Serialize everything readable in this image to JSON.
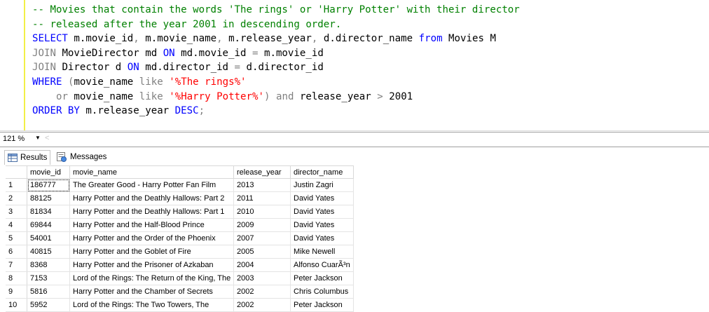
{
  "editor": {
    "lines": [
      [
        {
          "t": "-- Movies that contain the words 'The rings' or 'Harry Potter' with their director",
          "c": "cm"
        }
      ],
      [
        {
          "t": "-- released after the year 2001 in descending order.",
          "c": "cm"
        }
      ],
      [
        {
          "t": "SELECT",
          "c": "kw"
        },
        {
          "t": " m.movie_id",
          "c": ""
        },
        {
          "t": ",",
          "c": "op"
        },
        {
          "t": " m.movie_name",
          "c": ""
        },
        {
          "t": ",",
          "c": "op"
        },
        {
          "t": " m.release_year",
          "c": ""
        },
        {
          "t": ",",
          "c": "op"
        },
        {
          "t": " d.director_name ",
          "c": ""
        },
        {
          "t": "from",
          "c": "kw"
        },
        {
          "t": " Movies M",
          "c": ""
        }
      ],
      [
        {
          "t": "JOIN",
          "c": "op"
        },
        {
          "t": " MovieDirector md ",
          "c": ""
        },
        {
          "t": "ON",
          "c": "kw"
        },
        {
          "t": " md.movie_id ",
          "c": ""
        },
        {
          "t": "=",
          "c": "op"
        },
        {
          "t": " m.movie_id",
          "c": ""
        }
      ],
      [
        {
          "t": "JOIN",
          "c": "op"
        },
        {
          "t": " Director d ",
          "c": ""
        },
        {
          "t": "ON",
          "c": "kw"
        },
        {
          "t": " md.director_id ",
          "c": ""
        },
        {
          "t": "=",
          "c": "op"
        },
        {
          "t": " d.director_id",
          "c": ""
        }
      ],
      [
        {
          "t": "WHERE",
          "c": "kw"
        },
        {
          "t": " ",
          "c": ""
        },
        {
          "t": "(",
          "c": "op"
        },
        {
          "t": "movie_name ",
          "c": ""
        },
        {
          "t": "like",
          "c": "op"
        },
        {
          "t": " ",
          "c": ""
        },
        {
          "t": "'%The rings%'",
          "c": "str"
        }
      ],
      [
        {
          "t": "    ",
          "c": ""
        },
        {
          "t": "or",
          "c": "op"
        },
        {
          "t": " movie_name ",
          "c": ""
        },
        {
          "t": "like",
          "c": "op"
        },
        {
          "t": " ",
          "c": ""
        },
        {
          "t": "'%Harry Potter%'",
          "c": "str"
        },
        {
          "t": ")",
          "c": "op"
        },
        {
          "t": " ",
          "c": ""
        },
        {
          "t": "and",
          "c": "op"
        },
        {
          "t": " release_year ",
          "c": ""
        },
        {
          "t": ">",
          "c": "op"
        },
        {
          "t": " 2001",
          "c": ""
        }
      ],
      [
        {
          "t": "ORDER BY",
          "c": "kw"
        },
        {
          "t": " m.release_year ",
          "c": ""
        },
        {
          "t": "DESC",
          "c": "kw"
        },
        {
          "t": ";",
          "c": "op"
        }
      ]
    ]
  },
  "statusbar": {
    "zoom": "121 %",
    "scroll_left": "<"
  },
  "tabs": {
    "results": "Results",
    "messages": "Messages"
  },
  "grid": {
    "columns": [
      "movie_id",
      "movie_name",
      "release_year",
      "director_name"
    ],
    "rows": [
      [
        "1",
        "186777",
        "The Greater Good - Harry Potter Fan Film",
        "2013",
        "Justin Zagri"
      ],
      [
        "2",
        "88125",
        "Harry Potter and the Deathly Hallows: Part 2",
        "2011",
        "David Yates"
      ],
      [
        "3",
        "81834",
        "Harry Potter and the Deathly Hallows: Part 1",
        "2010",
        "David Yates"
      ],
      [
        "4",
        "69844",
        "Harry Potter and the Half-Blood Prince",
        "2009",
        "David Yates"
      ],
      [
        "5",
        "54001",
        "Harry Potter and the Order of the Phoenix",
        "2007",
        "David Yates"
      ],
      [
        "6",
        "40815",
        "Harry Potter and the Goblet of Fire",
        "2005",
        "Mike Newell"
      ],
      [
        "7",
        "8368",
        "Harry Potter and the Prisoner of Azkaban",
        "2004",
        "Alfonso CuarÃ³n"
      ],
      [
        "8",
        "7153",
        "Lord of the Rings: The Return of the King, The",
        "2003",
        "Peter Jackson"
      ],
      [
        "9",
        "5816",
        "Harry Potter and the Chamber of Secrets",
        "2002",
        "Chris Columbus"
      ],
      [
        "10",
        "5952",
        "Lord of the Rings: The Two Towers, The",
        "2002",
        "Peter Jackson"
      ]
    ]
  },
  "colors": {
    "comment": "#008000",
    "keyword": "#0000ff",
    "operator": "#808080",
    "string": "#ff0000",
    "change_bar": "#f2ef48"
  },
  "icons": {
    "results_tab": "grid-icon",
    "messages_tab": "messages-icon",
    "zoom_dropdown": "chevron-down-icon"
  }
}
